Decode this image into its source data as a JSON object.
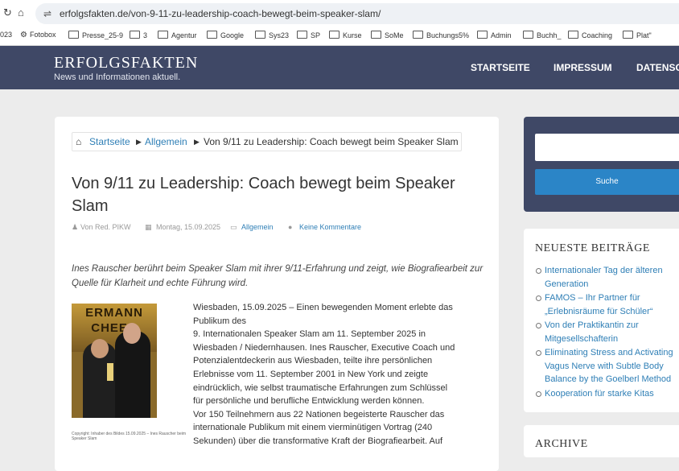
{
  "browser": {
    "nav_reload": "↻",
    "nav_home": "⌂",
    "url_icon": "⇌",
    "url": "erfolgsfakten.de/von-9-11-zu-leadership-coach-bewegt-beim-speaker-slam/",
    "bookmarks_partial": "023",
    "bookmarks": [
      "Fotobox",
      "Presse_25-9",
      "3",
      "Agentur",
      "Google",
      "Sys23",
      "SP",
      "Kurse",
      "SoMe",
      "Buchungs5%",
      "Admin",
      "Buchh_",
      "Coaching",
      "Plat\""
    ]
  },
  "site": {
    "brand": "ERFOLGSFAKTEN",
    "tagline": "News und Informationen aktuell.",
    "menu": [
      "STARTSEITE",
      "IMPRESSUM",
      "DATENSC"
    ]
  },
  "breadcrumb": {
    "home": "Startseite",
    "category": "Allgemein",
    "current": "Von 9/11 zu Leadership: Coach bewegt beim Speaker Slam"
  },
  "article": {
    "title": "Von 9/11 zu Leadership: Coach bewegt beim Speaker Slam",
    "meta": {
      "author": "Von Red. PIKW",
      "date": "Montag, 15.09.2025",
      "category": "Allgemein",
      "comments": "Keine Kommentare"
    },
    "lead": "Ines Rauscher berührt beim Speaker Slam mit ihrer 9/11-Erfahrung und zeigt, wie Biografiearbeit zur Quelle für Klarheit und echte Führung wird.",
    "image_text": "ERMANN\nCHEER",
    "image_caption": "Copyright: Inhaber des Bildes 15.09.2025 – Ines Rauscher beim Speaker Slam",
    "body_lines": [
      "Wiesbaden, 15.09.2025 – Einen bewegenden Moment erlebte das",
      "Publikum des",
      "9. Internationalen Speaker Slam am 11. September 2025 in",
      "Wiesbaden / Niedernhausen. Ines Rauscher, Executive Coach und",
      "Potenzialentdeckerin aus Wiesbaden, teilte ihre persönlichen",
      "Erlebnisse vom 11. September 2001 in New York und zeigte",
      "eindrücklich, wie selbst traumatische Erfahrungen zum Schlüssel",
      "für persönliche und berufliche Entwicklung werden können.",
      "Vor 150 Teilnehmern aus 22 Nationen begeisterte Rauscher das",
      "internationale Publikum mit einem vierminütigen Vortrag (240",
      "Sekunden) über die transformative Kraft der Biografiearbeit. Auf"
    ]
  },
  "sidebar": {
    "search_button": "Suche",
    "recent_title": "NEUESTE BEITRÄGE",
    "recent_posts": [
      [
        "Internationaler Tag der älteren",
        "Generation"
      ],
      [
        "FAMOS – Ihr Partner für",
        "„Erlebnisräume für Schüler“"
      ],
      [
        "Von der Praktikantin zur",
        "Mitgesellschafterin"
      ],
      [
        "Eliminating Stress and Activating",
        "Vagus Nerve with Subtle Body",
        "Balance by the Goelberl Method"
      ],
      [
        "Kooperation für starke Kitas"
      ]
    ],
    "archive_title": "ARCHIVE"
  },
  "colors": {
    "header_bg": "#3f4866",
    "link": "#2f7fb6",
    "search_button": "#2b85c7"
  }
}
